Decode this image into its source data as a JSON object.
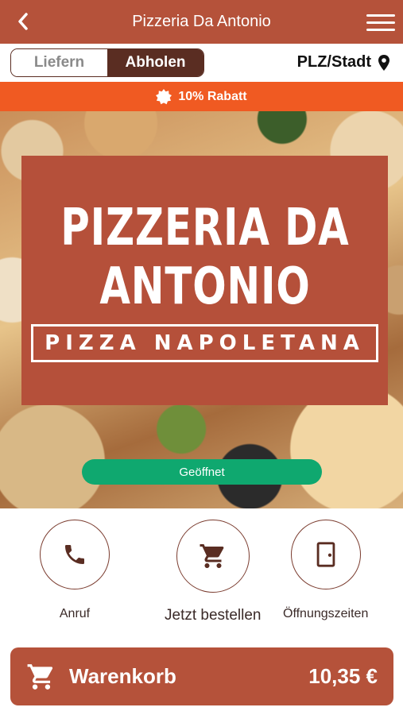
{
  "header": {
    "title": "Pizzeria Da Antonio"
  },
  "mode": {
    "options": [
      "Liefern",
      "Abholen"
    ],
    "selected": "Abholen",
    "location_label": "PLZ/Stadt"
  },
  "promo": {
    "text": "10% Rabatt"
  },
  "hero": {
    "logo_line1": "PIZZERIA DA",
    "logo_line2": "ANTONIO",
    "logo_sub": "PIZZA NAPOLETANA",
    "status": "Geöffnet"
  },
  "actions": [
    {
      "label": "Anruf",
      "icon": "phone-icon"
    },
    {
      "label": "Jetzt bestellen",
      "icon": "cart-icon"
    },
    {
      "label": "Öffnungszeiten",
      "icon": "door-icon"
    }
  ],
  "cart": {
    "label": "Warenkorb",
    "total": "10,35 €"
  },
  "colors": {
    "brand": "#b5523a",
    "dark": "#5a2d22",
    "promo": "#f05a22",
    "status": "#0fa86f"
  }
}
